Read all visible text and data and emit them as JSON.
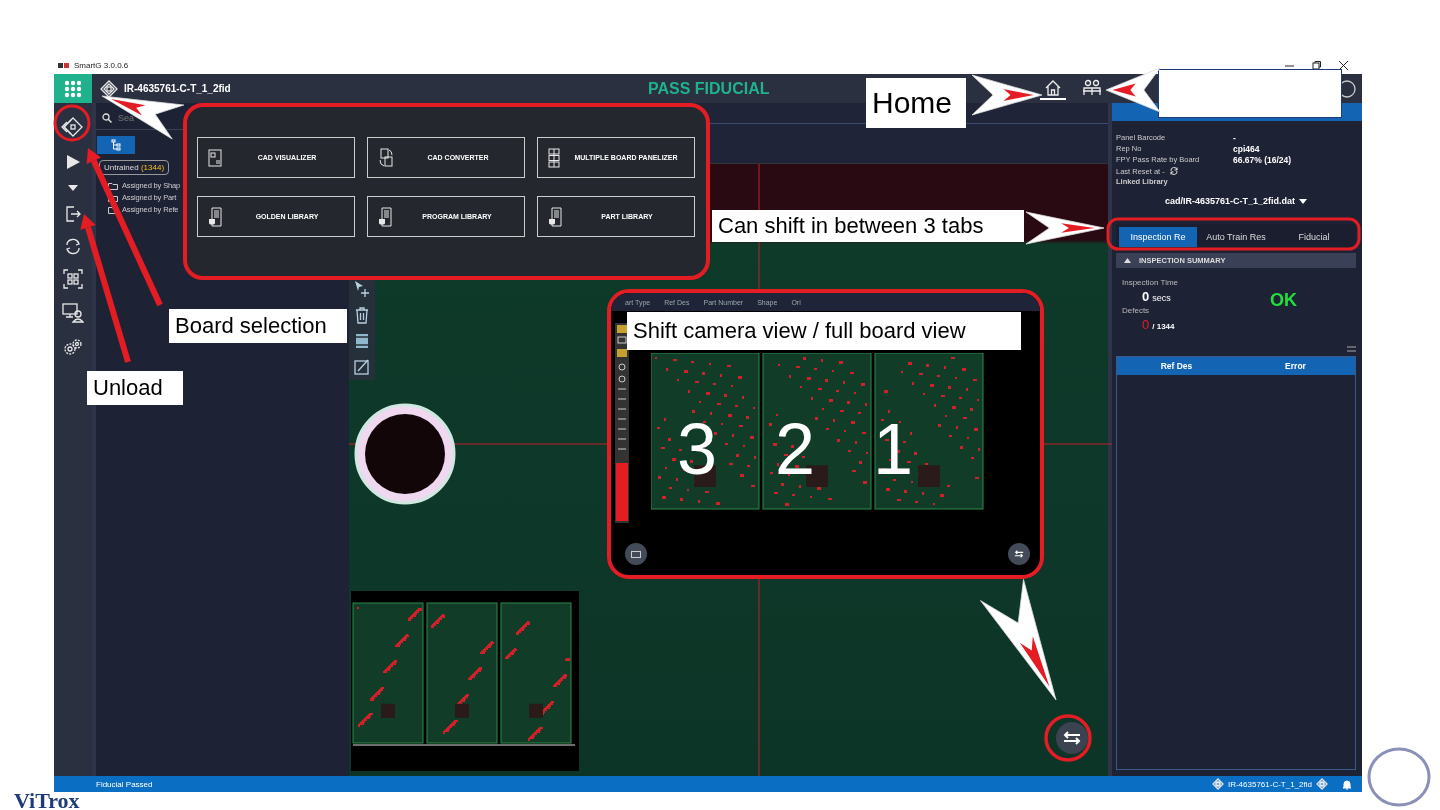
{
  "window": {
    "title": "SmartG 3.0.0.6"
  },
  "header": {
    "board_name": "IR-4635761-C-T_1_2fid",
    "status": "PASS FIDUCIAL",
    "nav": [
      {
        "kind": "home",
        "selected": true
      },
      {
        "kind": "operators",
        "selected": false
      }
    ]
  },
  "rail": [
    {
      "kind": "boards"
    },
    {
      "kind": "play"
    },
    {
      "kind": "caret"
    },
    {
      "kind": "unload"
    },
    {
      "kind": "cycle"
    },
    {
      "kind": "grid"
    },
    {
      "kind": "monitor-user"
    },
    {
      "kind": "settings"
    }
  ],
  "library_menu": [
    {
      "label": "CAD VISUALIZER",
      "kind": "cad"
    },
    {
      "label": "CAD CONVERTER",
      "kind": "convert"
    },
    {
      "label": "MULTIPLE BOARD PANELIZER",
      "kind": "panel"
    },
    {
      "label": "GOLDEN LIBRARY",
      "kind": "library"
    },
    {
      "label": "PROGRAM LIBRARY",
      "kind": "library"
    },
    {
      "label": "PART LIBRARY",
      "kind": "library"
    }
  ],
  "left_panel": {
    "search": {
      "placeholder": "Sea"
    },
    "chip": {
      "label": "Untrained",
      "count": "(1344)"
    },
    "tree": [
      {
        "label": "Assigned by Shap"
      },
      {
        "label": "Assigned by Part"
      },
      {
        "label": "Assigned by Refe"
      }
    ]
  },
  "canvas": {
    "tools": [
      {
        "kind": "move"
      },
      {
        "kind": "delete"
      },
      {
        "kind": "component"
      },
      {
        "kind": "edit"
      }
    ],
    "board_view": {
      "columns": [
        "art Type",
        "Ref Des",
        "Part Number",
        "Shape",
        "Ori"
      ],
      "boards": [
        "3",
        "2",
        "1"
      ]
    }
  },
  "right_panel": {
    "info": [
      {
        "label": "Panel Barcode",
        "value": "-"
      },
      {
        "label": "Rep No",
        "value": "cpi464"
      },
      {
        "label": "FPY Pass Rate by Board",
        "value": "66.67%  (16/24)"
      },
      {
        "label": "Last Reset at -",
        "kind": "reset"
      },
      {
        "label": "Linked Library",
        "kind": "bold"
      }
    ],
    "library": "cad/IR-4635761-C-T_1_2fid.dat",
    "tabs": [
      {
        "label": "Inspection Re",
        "selected": true
      },
      {
        "label": "Auto Train Res",
        "selected": false
      },
      {
        "label": "Fiducial",
        "selected": false
      }
    ],
    "section": {
      "title": "INSPECTION SUMMARY",
      "expanded": true
    },
    "inspection_time_label": "Inspection Time",
    "inspection_time": "0",
    "inspection_time_unit": "secs",
    "defects_label": "Defects",
    "defects": "0",
    "defects_total": "/ 1344",
    "result": "OK",
    "table": {
      "columns": [
        "Ref Des",
        "Error"
      ]
    }
  },
  "status_bar": {
    "message": "Fiducial Passed",
    "board_name": "IR-4635761-C-T_1_2fid"
  },
  "annotations": [
    {
      "kind": "home",
      "text": "Home"
    },
    {
      "kind": "help"
    },
    {
      "kind": "tabs",
      "text": "Can shift in between 3 tabs"
    },
    {
      "kind": "board-selection",
      "text": "Board selection"
    },
    {
      "kind": "unload",
      "text": "Unload"
    },
    {
      "kind": "board-view",
      "text": "Shift camera view / full board view"
    }
  ],
  "brand": {
    "logo": "ViTrox"
  }
}
